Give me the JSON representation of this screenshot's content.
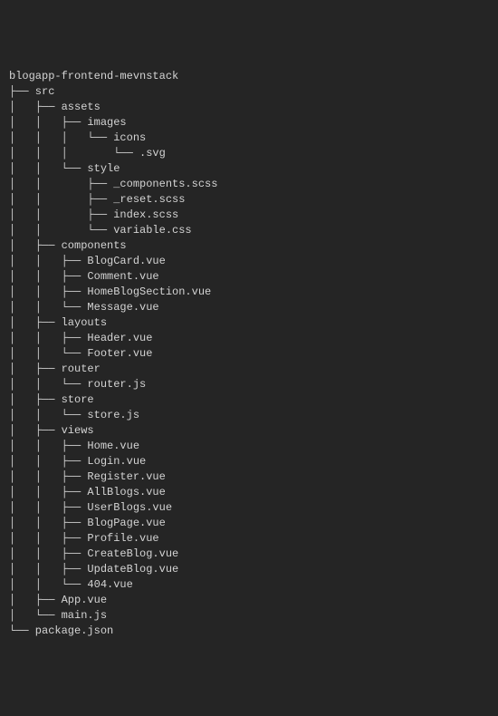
{
  "tree": {
    "root": "blogapp-frontend-mevnstack",
    "lines": [
      {
        "prefix": "├── ",
        "name": "src"
      },
      {
        "prefix": "│   ├── ",
        "name": "assets"
      },
      {
        "prefix": "│   │   ├── ",
        "name": "images"
      },
      {
        "prefix": "│   │   │   └── ",
        "name": "icons"
      },
      {
        "prefix": "│   │   │       └── ",
        "name": ".svg"
      },
      {
        "prefix": "│   │   └── ",
        "name": "style"
      },
      {
        "prefix": "│   │       ├── ",
        "name": "_components.scss"
      },
      {
        "prefix": "│   │       ├── ",
        "name": "_reset.scss"
      },
      {
        "prefix": "│   │       ├── ",
        "name": "index.scss"
      },
      {
        "prefix": "│   │       └── ",
        "name": "variable.css"
      },
      {
        "prefix": "│   ├── ",
        "name": "components"
      },
      {
        "prefix": "│   │   ├── ",
        "name": "BlogCard.vue"
      },
      {
        "prefix": "│   │   ├── ",
        "name": "Comment.vue"
      },
      {
        "prefix": "│   │   ├── ",
        "name": "HomeBlogSection.vue"
      },
      {
        "prefix": "│   │   └── ",
        "name": "Message.vue"
      },
      {
        "prefix": "│   ├── ",
        "name": "layouts"
      },
      {
        "prefix": "│   │   ├── ",
        "name": "Header.vue"
      },
      {
        "prefix": "│   │   └── ",
        "name": "Footer.vue"
      },
      {
        "prefix": "│   ├── ",
        "name": "router"
      },
      {
        "prefix": "│   │   └── ",
        "name": "router.js"
      },
      {
        "prefix": "│   ├── ",
        "name": "store"
      },
      {
        "prefix": "│   │   └── ",
        "name": "store.js"
      },
      {
        "prefix": "│   ├── ",
        "name": "views"
      },
      {
        "prefix": "│   │   ├── ",
        "name": "Home.vue"
      },
      {
        "prefix": "│   │   ├── ",
        "name": "Login.vue"
      },
      {
        "prefix": "│   │   ├── ",
        "name": "Register.vue"
      },
      {
        "prefix": "│   │   ├── ",
        "name": "AllBlogs.vue"
      },
      {
        "prefix": "│   │   ├── ",
        "name": "UserBlogs.vue"
      },
      {
        "prefix": "│   │   ├── ",
        "name": "BlogPage.vue"
      },
      {
        "prefix": "│   │   ├── ",
        "name": "Profile.vue"
      },
      {
        "prefix": "│   │   ├── ",
        "name": "CreateBlog.vue"
      },
      {
        "prefix": "│   │   ├── ",
        "name": "UpdateBlog.vue"
      },
      {
        "prefix": "│   │   └── ",
        "name": "404.vue"
      },
      {
        "prefix": "│   ├── ",
        "name": "App.vue"
      },
      {
        "prefix": "│   └── ",
        "name": "main.js"
      },
      {
        "prefix": "└── ",
        "name": "package.json"
      }
    ]
  }
}
